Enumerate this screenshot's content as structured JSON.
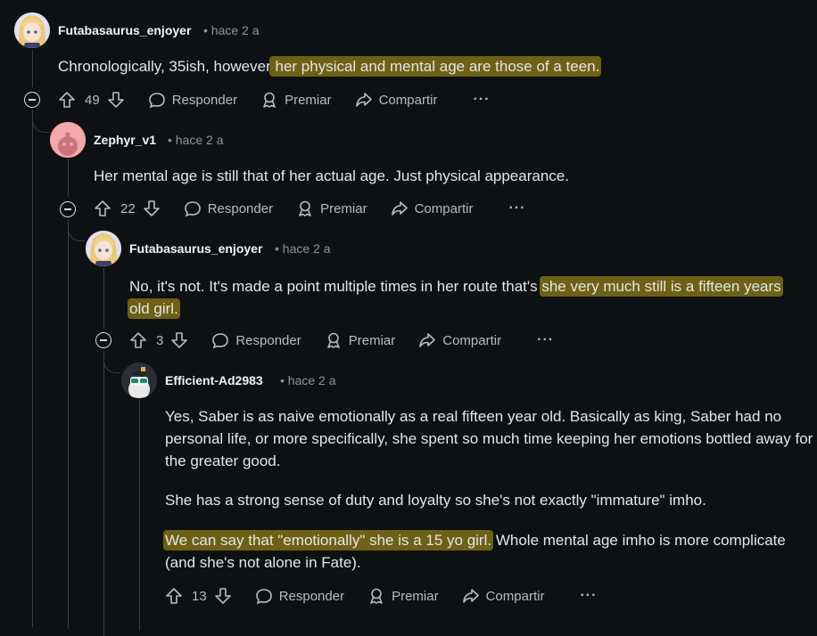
{
  "actions": {
    "reply": "Responder",
    "award": "Premiar",
    "share": "Compartir",
    "more": "···"
  },
  "comments": [
    {
      "user": "Futabasaurus_enjoyer",
      "time": "• hace 2 a",
      "score": "49",
      "text_plain": "Chronologically, 35ish, however",
      "text_highlight": " her physical and mental age are those of a teen."
    },
    {
      "user": "Zephyr_v1",
      "time": "• hace 2 a",
      "score": "22",
      "text_plain": "Her mental age is still that of her actual age. Just physical appearance."
    },
    {
      "user": "Futabasaurus_enjoyer",
      "time": "• hace 2 a",
      "score": "3",
      "text_plain": "No, it's not. It's made a point multiple times in her route that's ",
      "text_highlight_1": "she very much still is a fifteen years",
      "text_highlight_2": "old girl."
    },
    {
      "user": "Efficient-Ad2983",
      "time": "• hace 2 a",
      "score": "13",
      "p1": "Yes, Saber is as naive emotionally as a real fifteen year old. Basically as king, Saber had no personal life, or more specifically, she spent so much time keeping her emotions bottled away for the greater good.",
      "p2": "She has a strong sense of duty and loyalty so she's not exactly \"immature\" imho.",
      "p3_highlight": "We can say that \"emotionally\" she is a 15 yo girl.",
      "p3_rest": " Whole mental age imho is more complicate (and she's not alone in Fate)."
    }
  ],
  "colors": {
    "background": "#0e1113",
    "highlight": "#6e6014",
    "thread_line": "#3a3f43",
    "zephyr_avatar": "#f4a7ad"
  }
}
